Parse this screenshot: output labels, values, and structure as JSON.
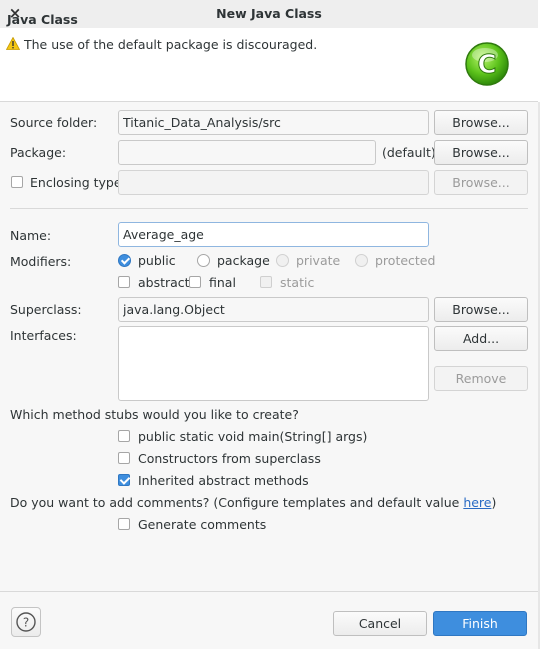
{
  "window": {
    "title": "New Java Class",
    "close_glyph": "×"
  },
  "header": {
    "title": "Java Class",
    "message": "The use of the default package is discouraged.",
    "warning_icon": "warning-icon",
    "logo_icon": "class-logo-icon",
    "logo_letter": "C"
  },
  "source_folder": {
    "label": "Source folder:",
    "value": "Titanic_Data_Analysis/src",
    "browse": "Browse..."
  },
  "package": {
    "label": "Package:",
    "value": "",
    "default_note": "(default)",
    "browse": "Browse..."
  },
  "enclosing": {
    "label": "Enclosing type:",
    "value": "",
    "checked": false,
    "browse": "Browse..."
  },
  "name": {
    "label": "Name:",
    "value": "Average_age"
  },
  "modifiers": {
    "label": "Modifiers:",
    "access": [
      {
        "label": "public",
        "selected": true,
        "enabled": true
      },
      {
        "label": "package",
        "selected": false,
        "enabled": true
      },
      {
        "label": "private",
        "selected": false,
        "enabled": false
      },
      {
        "label": "protected",
        "selected": false,
        "enabled": false
      }
    ],
    "flags": [
      {
        "label": "abstract",
        "checked": false,
        "enabled": true
      },
      {
        "label": "final",
        "checked": false,
        "enabled": true
      },
      {
        "label": "static",
        "checked": false,
        "enabled": false
      }
    ]
  },
  "superclass": {
    "label": "Superclass:",
    "value": "java.lang.Object",
    "browse": "Browse..."
  },
  "interfaces": {
    "label": "Interfaces:",
    "add": "Add...",
    "remove": "Remove"
  },
  "stubs": {
    "question": "Which method stubs would you like to create?",
    "options": [
      {
        "label": "public static void main(String[] args)",
        "checked": false
      },
      {
        "label": "Constructors from superclass",
        "checked": false
      },
      {
        "label": "Inherited abstract methods",
        "checked": true
      }
    ]
  },
  "comments": {
    "question": "Do you want to add comments? (Configure templates and default value ",
    "link": "here",
    "question_end": ")",
    "option": {
      "label": "Generate comments",
      "checked": false
    }
  },
  "footer": {
    "help_glyph": "?",
    "cancel": "Cancel",
    "finish": "Finish"
  },
  "colors": {
    "accent": "#3e8ede",
    "warning": "#f0c000",
    "logo_green": "#5cc21b"
  }
}
